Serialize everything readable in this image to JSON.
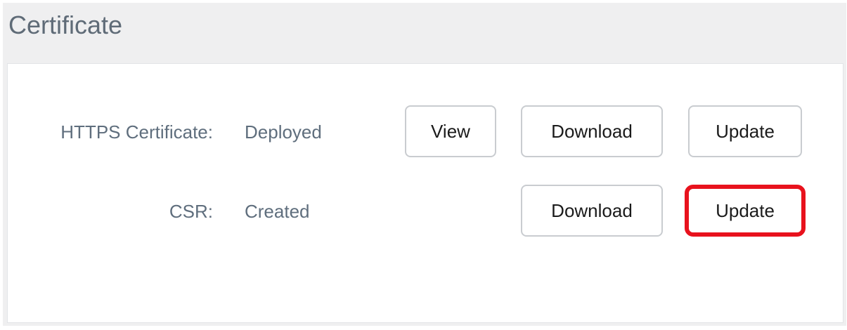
{
  "section": {
    "title": "Certificate"
  },
  "https_certificate": {
    "label": "HTTPS Certificate:",
    "status": "Deployed",
    "view_label": "View",
    "download_label": "Download",
    "update_label": "Update"
  },
  "csr": {
    "label": "CSR:",
    "status": "Created",
    "download_label": "Download",
    "update_label": "Update"
  },
  "colors": {
    "highlight": "#e8121d",
    "panel_background": "#efeff0",
    "label_text": "#5f6e7d"
  }
}
